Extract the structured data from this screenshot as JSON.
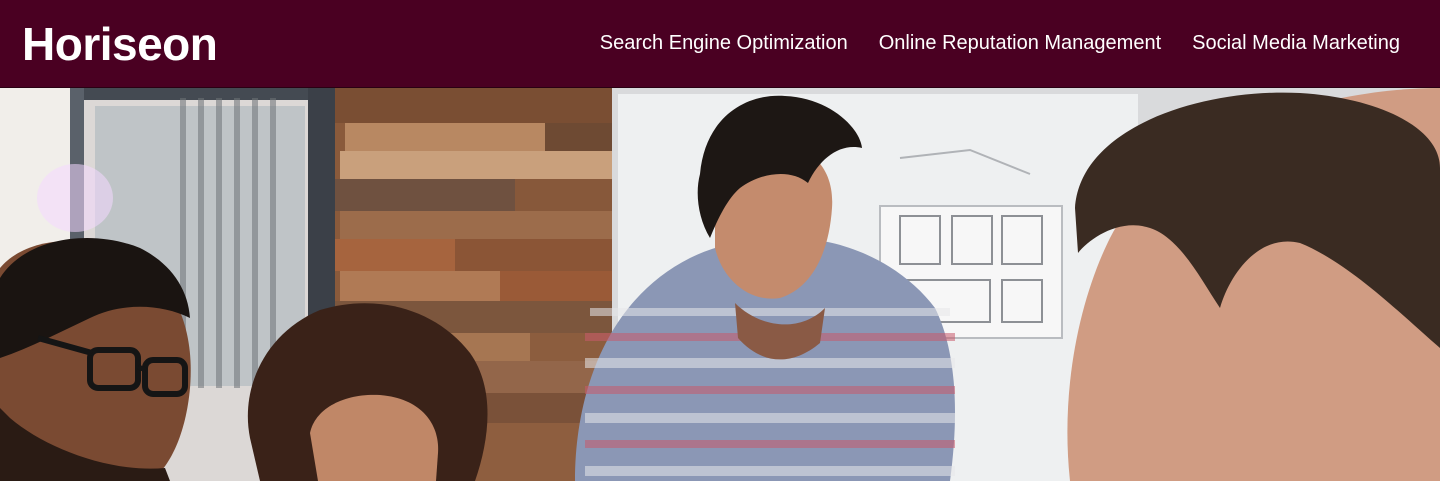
{
  "header": {
    "brand": "Horiseon",
    "nav": [
      {
        "label": "Search Engine Optimization"
      },
      {
        "label": "Online Reputation Management"
      },
      {
        "label": "Social Media Marketing"
      }
    ]
  },
  "hero": {
    "image_subject": "team-meeting-photo",
    "colors": {
      "header_bg": "#4a0022",
      "nav_text": "#ffffff"
    }
  }
}
